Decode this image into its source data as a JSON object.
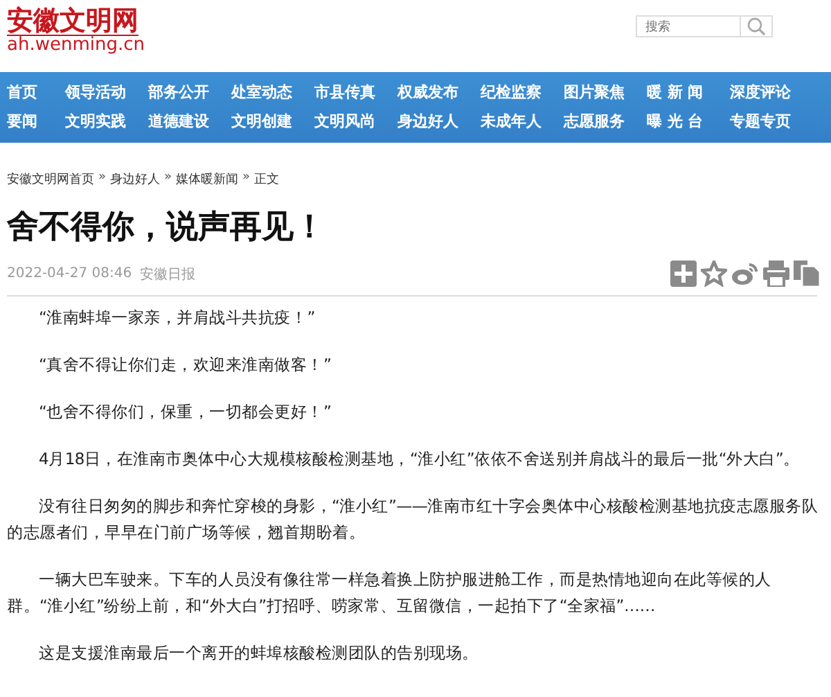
{
  "site": {
    "name": "安徽文明网",
    "domain": "ah.wenming.cn"
  },
  "search": {
    "placeholder": "搜索"
  },
  "nav": [
    [
      "首页",
      "领导活动",
      "部务公开",
      "处室动态",
      "市县传真",
      "权威发布",
      "纪检监察",
      "图片聚焦",
      "暖 新 闻",
      "深度评论"
    ],
    [
      "要闻",
      "文明实践",
      "道德建设",
      "文明创建",
      "文明风尚",
      "身边好人",
      "未成年人",
      "志愿服务",
      "曝 光 台",
      "专题专页"
    ]
  ],
  "breadcrumb": {
    "separator": "»",
    "items": [
      "安徽文明网首页",
      "身边好人",
      "媒体暖新闻",
      "正文"
    ]
  },
  "article": {
    "title": "舍不得你，说声再见！",
    "date": "2022-04-27 08:46",
    "source": "安徽日报",
    "paragraphs": [
      "“淮南蚌埠一家亲，并肩战斗共抗疫！”",
      "“真舍不得让你们走，欢迎来淮南做客！”",
      "“也舍不得你们，保重，一切都会更好！”",
      "4月18日，在淮南市奥体中心大规模核酸检测基地，“淮小红”依依不舍送别并肩战斗的最后一批“外大白”。",
      "没有往日匆匆的脚步和奔忙穿梭的身影，“淮小红”——淮南市红十字会奥体中心核酸检测基地抗疫志愿服务队的志愿者们，早早在门前广场等候，翘首期盼着。",
      "一辆大巴车驶来。下车的人员没有像往常一样急着换上防护服进舱工作，而是热情地迎向在此等候的人群。“淮小红”纷纷上前，和“外大白”打招呼、唠家常、互留微信，一起拍下了“全家福”……",
      "这是支援淮南最后一个离开的蚌埠核酸检测团队的告别现场。"
    ]
  }
}
